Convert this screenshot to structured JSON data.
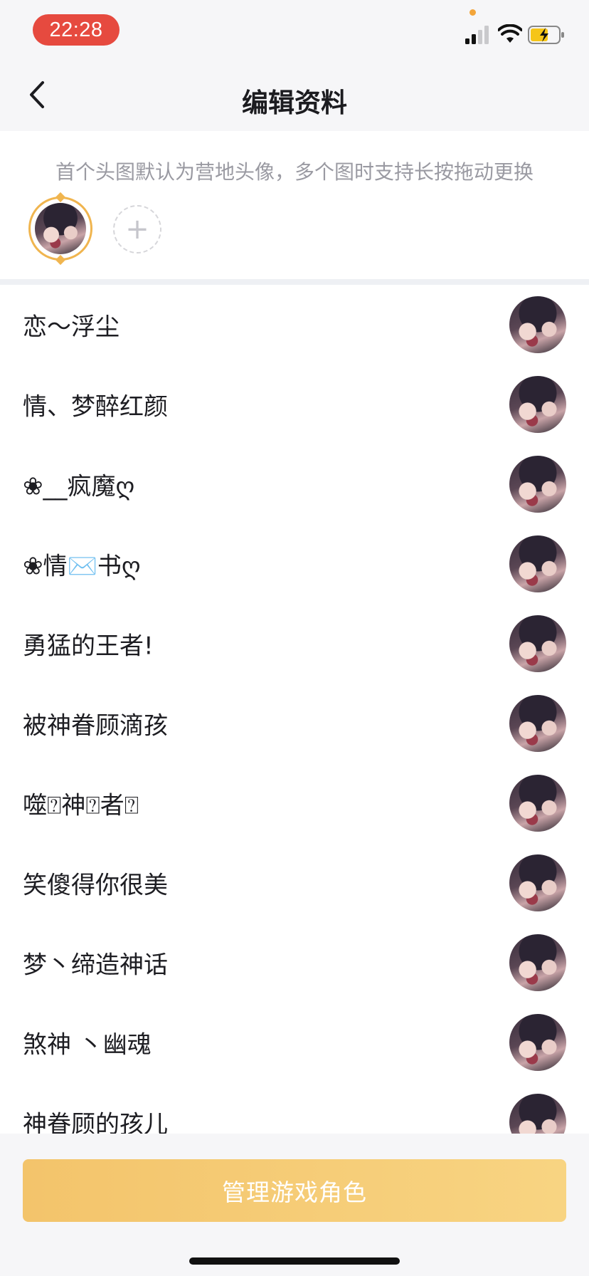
{
  "status_bar": {
    "time": "22:28",
    "signal_icon": "cellular-signal-icon",
    "wifi_icon": "wifi-icon",
    "battery_icon": "battery-charging-icon"
  },
  "nav": {
    "title": "编辑资料",
    "back_icon": "chevron-left-icon"
  },
  "avatar_section": {
    "hint": "首个头图默认为营地头像，多个图时支持长按拖动更换",
    "add_label": "+"
  },
  "roles": [
    {
      "name": "恋～浮尘"
    },
    {
      "name": "情、梦醉红颜"
    },
    {
      "name": "❀__疯魔ღ"
    },
    {
      "name": "❀情✉️书ღ"
    },
    {
      "name": " 勇猛的王者!"
    },
    {
      "name": "被神眷顾滴孩"
    },
    {
      "name": "噬⍰神⍰者⍰"
    },
    {
      "name": "笑傻得你很美"
    },
    {
      "name": "梦丶缔造神话"
    },
    {
      "name": "煞神 丶幽魂"
    },
    {
      "name": "神眷顾的孩儿"
    }
  ],
  "footer": {
    "manage_button": "管理游戏角色"
  },
  "colors": {
    "accent": "#f0b54f",
    "button_start": "#f3c46b",
    "button_end": "#f8d482",
    "time_pill": "#e64a3f"
  }
}
